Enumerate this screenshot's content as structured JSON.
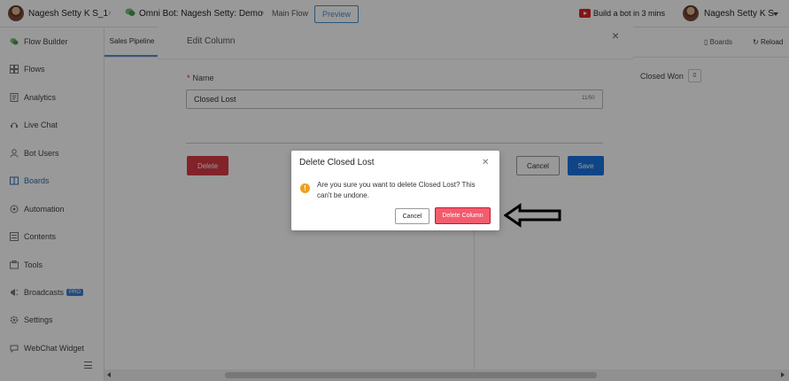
{
  "topbar": {
    "account_name": "Nagesh Setty K S_1",
    "bot_name": "Omni Bot: Nagesh Setty: Demo",
    "flow_name": "Main Flow",
    "preview_label": "Preview",
    "build_video_label": "Build a bot in 3 mins",
    "user_name": "Nagesh Setty K S"
  },
  "sidebar": {
    "items": [
      {
        "label": "Flow Builder",
        "icon": "flow-builder-icon"
      },
      {
        "label": "Flows",
        "icon": "flows-icon"
      },
      {
        "label": "Analytics",
        "icon": "analytics-icon"
      },
      {
        "label": "Live Chat",
        "icon": "live-chat-icon"
      },
      {
        "label": "Bot Users",
        "icon": "bot-users-icon"
      },
      {
        "label": "Boards",
        "icon": "boards-icon"
      },
      {
        "label": "Automation",
        "icon": "automation-icon"
      },
      {
        "label": "Contents",
        "icon": "contents-icon"
      },
      {
        "label": "Tools",
        "icon": "tools-icon"
      },
      {
        "label": "Broadcasts",
        "icon": "broadcasts-icon",
        "badge": "PRO"
      },
      {
        "label": "Settings",
        "icon": "settings-icon"
      },
      {
        "label": "WebChat Widget",
        "icon": "webchat-icon"
      }
    ]
  },
  "board": {
    "tab_label": "Sales Pipeline",
    "boards_button": "Boards",
    "reload_button": "Reload",
    "column_closed_won": "Closed Won",
    "column_closed_won_count": "0"
  },
  "edit_dialog": {
    "title": "Edit Column",
    "name_label": "Name",
    "name_value": "Closed Lost",
    "char_count": "11/50",
    "delete_label": "Delete",
    "cancel_label": "Cancel",
    "save_label": "Save"
  },
  "confirm_dialog": {
    "title": "Delete Closed Lost",
    "message": "Are you sure you want to delete Closed Lost? This can't be undone.",
    "cancel_label": "Cancel",
    "delete_label": "Delete Column"
  },
  "colors": {
    "primary": "#1a73e0",
    "danger": "#d93a45",
    "delete_column": "#f45b6d",
    "warning": "#f0a020",
    "active_nav": "#2f6fb3"
  }
}
